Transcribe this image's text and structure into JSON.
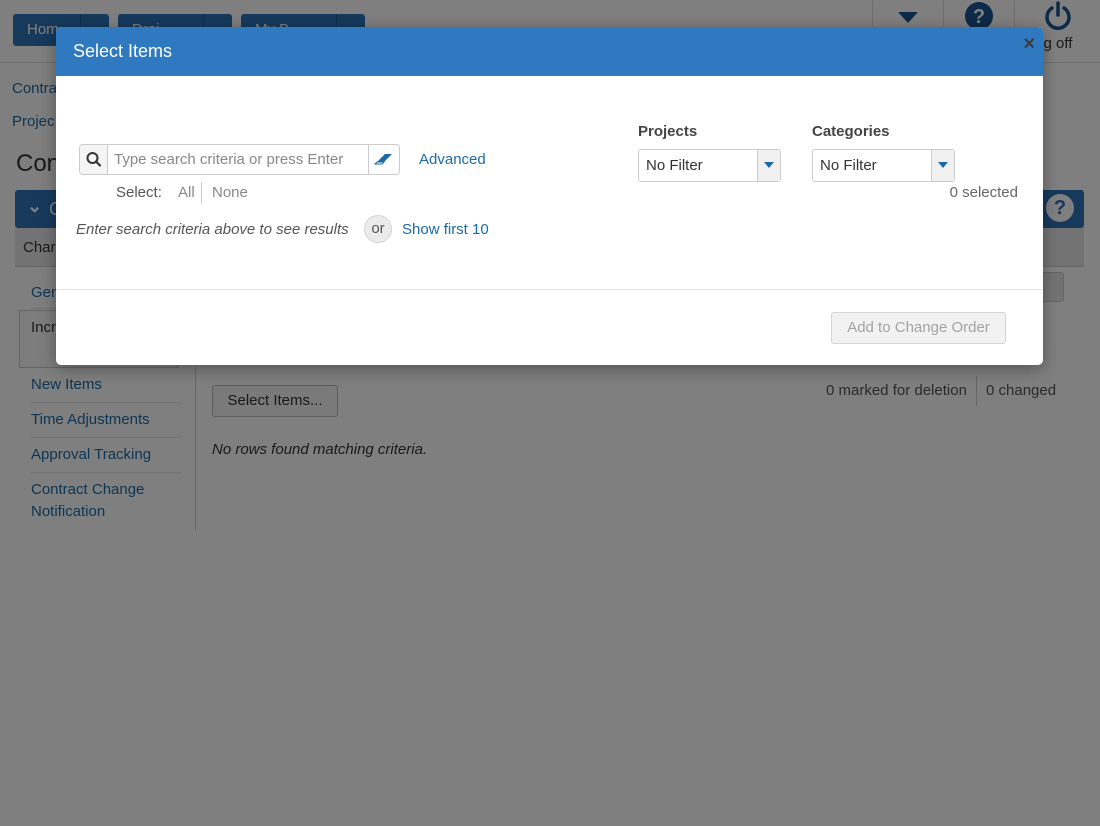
{
  "modal": {
    "title": "Select Items",
    "close_glyph": "×",
    "search": {
      "placeholder": "Type search criteria or press Enter",
      "value": ""
    },
    "advanced_label": "Advanced",
    "select_label": "Select:",
    "select_all_label": "All",
    "select_none_label": "None",
    "hint_text": "Enter search criteria above to see results",
    "or_label": "or",
    "show_first_label": "Show first 10",
    "projects": {
      "label": "Projects",
      "value": "No Filter"
    },
    "categories": {
      "label": "Categories",
      "value": "No Filter"
    },
    "selected_count": "0 selected",
    "add_button_label": "Add to Change Order"
  },
  "background": {
    "nav_buttons": [
      "Hom",
      "Droj",
      "My B"
    ],
    "log_off_label": "g off",
    "breadcrumbs": [
      "Contra",
      "Projec"
    ],
    "page_title": "Con",
    "panel_title": "C",
    "tab_label": "Char",
    "sidebar_items": [
      "Gen",
      "Incr Item",
      "New Items",
      "Time Adjustments",
      "Approval Tracking",
      "Contract Change Notification"
    ],
    "select_items_button": "Select Items...",
    "marked_for_deletion": "0 marked for deletion",
    "changed_count": "0 changed",
    "no_rows_text": "No rows found matching criteria."
  },
  "colors": {
    "header_blue": "#2e79c0",
    "link_blue": "#1a6aa8",
    "overlay": "rgba(0,0,0,0.5)"
  }
}
